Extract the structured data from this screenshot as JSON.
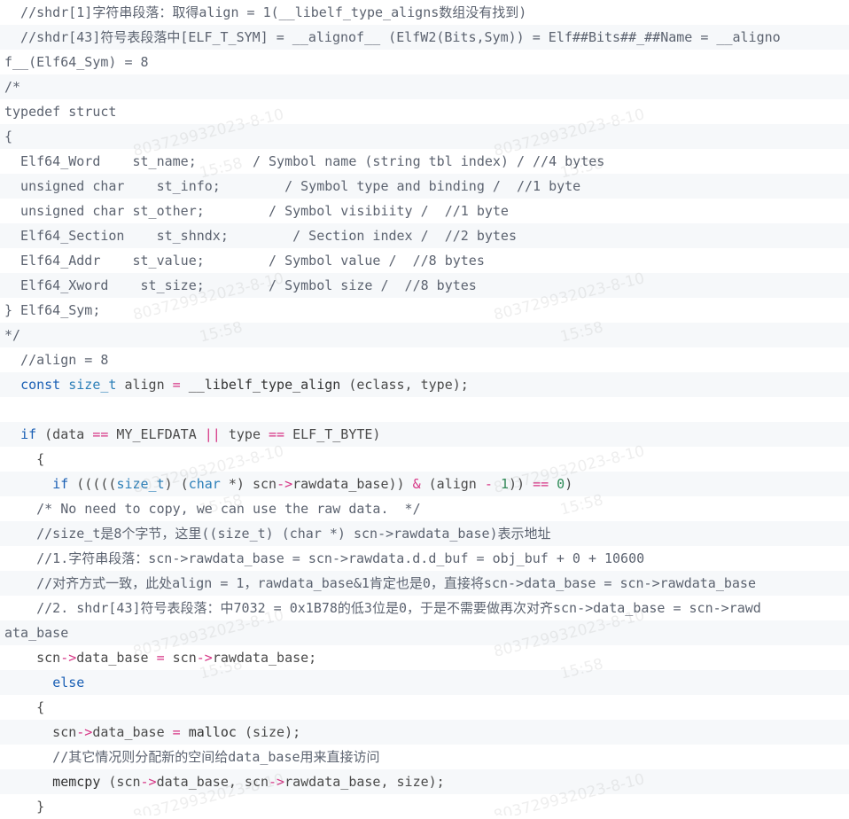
{
  "code_block": {
    "lines": [
      {
        "segments": [
          {
            "t": "  //shdr[1]字符串段落：取得align = 1(__libelf_type_aligns数组没有找到)",
            "c": "cm"
          }
        ]
      },
      {
        "segments": [
          {
            "t": "  //shdr[43]符号表段落中[ELF_T_SYM] = __alignof__ (ElfW2(Bits,Sym)) = Elf##Bits##_##Name = __aligno",
            "c": "cm"
          }
        ]
      },
      {
        "segments": [
          {
            "t": "f__(Elf64_Sym) = 8",
            "c": "cm"
          }
        ]
      },
      {
        "segments": [
          {
            "t": "/*",
            "c": "cm"
          }
        ]
      },
      {
        "segments": [
          {
            "t": "typedef struct",
            "c": "cm"
          }
        ]
      },
      {
        "segments": [
          {
            "t": "{",
            "c": "cm"
          }
        ]
      },
      {
        "segments": [
          {
            "t": "  Elf64_Word    st_name;       / Symbol name (string tbl index) / //4 bytes",
            "c": "cm"
          }
        ]
      },
      {
        "segments": [
          {
            "t": "  unsigned char    st_info;        / Symbol type and binding /  //1 byte",
            "c": "cm"
          }
        ]
      },
      {
        "segments": [
          {
            "t": "  unsigned char st_other;        / Symbol visibiity /  //1 byte",
            "c": "cm"
          }
        ]
      },
      {
        "segments": [
          {
            "t": "  Elf64_Section    st_shndx;        / Section index /  //2 bytes",
            "c": "cm"
          }
        ]
      },
      {
        "segments": [
          {
            "t": "  Elf64_Addr    st_value;        / Symbol value /  //8 bytes",
            "c": "cm"
          }
        ]
      },
      {
        "segments": [
          {
            "t": "  Elf64_Xword    st_size;        / Symbol size /  //8 bytes",
            "c": "cm"
          }
        ]
      },
      {
        "segments": [
          {
            "t": "} Elf64_Sym;",
            "c": "cm"
          }
        ]
      },
      {
        "segments": [
          {
            "t": "*/",
            "c": "cm"
          }
        ]
      },
      {
        "segments": [
          {
            "t": "  //align = 8",
            "c": "cm"
          }
        ]
      },
      {
        "segments": [
          {
            "t": "  ",
            "c": "tx"
          },
          {
            "t": "const",
            "c": "kw"
          },
          {
            "t": " ",
            "c": "tx"
          },
          {
            "t": "size_t",
            "c": "ty"
          },
          {
            "t": " align ",
            "c": "tx"
          },
          {
            "t": "=",
            "c": "op"
          },
          {
            "t": " __libelf_type_align ",
            "c": "fn"
          },
          {
            "t": "(eclass, type);",
            "c": "tx"
          }
        ]
      },
      {
        "segments": [
          {
            "t": "",
            "c": "tx"
          }
        ]
      },
      {
        "segments": [
          {
            "t": "  ",
            "c": "tx"
          },
          {
            "t": "if",
            "c": "kw"
          },
          {
            "t": " (data ",
            "c": "tx"
          },
          {
            "t": "==",
            "c": "op"
          },
          {
            "t": " MY_ELFDATA ",
            "c": "tx"
          },
          {
            "t": "||",
            "c": "op"
          },
          {
            "t": " type ",
            "c": "tx"
          },
          {
            "t": "==",
            "c": "op"
          },
          {
            "t": " ELF_T_BYTE)",
            "c": "tx"
          }
        ]
      },
      {
        "segments": [
          {
            "t": "    {",
            "c": "tx"
          }
        ]
      },
      {
        "segments": [
          {
            "t": "      ",
            "c": "tx"
          },
          {
            "t": "if",
            "c": "kw"
          },
          {
            "t": " (((((",
            "c": "tx"
          },
          {
            "t": "size_t",
            "c": "ty"
          },
          {
            "t": ") (",
            "c": "tx"
          },
          {
            "t": "char",
            "c": "ty"
          },
          {
            "t": " *) scn",
            "c": "tx"
          },
          {
            "t": "->",
            "c": "op"
          },
          {
            "t": "rawdata_base)) ",
            "c": "tx"
          },
          {
            "t": "&",
            "c": "op"
          },
          {
            "t": " (align ",
            "c": "tx"
          },
          {
            "t": "-",
            "c": "op"
          },
          {
            "t": " ",
            "c": "tx"
          },
          {
            "t": "1",
            "c": "num"
          },
          {
            "t": ")) ",
            "c": "tx"
          },
          {
            "t": "==",
            "c": "op"
          },
          {
            "t": " ",
            "c": "tx"
          },
          {
            "t": "0",
            "c": "num"
          },
          {
            "t": ")",
            "c": "tx"
          }
        ]
      },
      {
        "segments": [
          {
            "t": "    /* No need to copy, we can use the raw data.  */",
            "c": "cm"
          }
        ]
      },
      {
        "segments": [
          {
            "t": "    //size_t是8个字节，这里((size_t) (char *) scn->rawdata_base)表示地址",
            "c": "cm"
          }
        ]
      },
      {
        "segments": [
          {
            "t": "    //1.字符串段落：scn->rawdata_base = scn->rawdata.d.d_buf = obj_buf + 0 + 10600",
            "c": "cm"
          }
        ]
      },
      {
        "segments": [
          {
            "t": "    //对齐方式一致，此处align = 1，rawdata_base&1肯定也是0，直接将scn->data_base = scn->rawdata_base",
            "c": "cm"
          }
        ]
      },
      {
        "segments": [
          {
            "t": "    //2. shdr[43]符号表段落：中7032 = 0x1B78的低3位是0，于是不需要做再次对齐scn->data_base = scn->rawd",
            "c": "cm"
          }
        ]
      },
      {
        "segments": [
          {
            "t": "ata_base",
            "c": "cm"
          }
        ]
      },
      {
        "segments": [
          {
            "t": "    scn",
            "c": "tx"
          },
          {
            "t": "->",
            "c": "op"
          },
          {
            "t": "data_base ",
            "c": "tx"
          },
          {
            "t": "=",
            "c": "op"
          },
          {
            "t": " scn",
            "c": "tx"
          },
          {
            "t": "->",
            "c": "op"
          },
          {
            "t": "rawdata_base;",
            "c": "tx"
          }
        ]
      },
      {
        "segments": [
          {
            "t": "      ",
            "c": "tx"
          },
          {
            "t": "else",
            "c": "kw"
          }
        ]
      },
      {
        "segments": [
          {
            "t": "    {",
            "c": "tx"
          }
        ]
      },
      {
        "segments": [
          {
            "t": "      scn",
            "c": "tx"
          },
          {
            "t": "->",
            "c": "op"
          },
          {
            "t": "data_base ",
            "c": "tx"
          },
          {
            "t": "=",
            "c": "op"
          },
          {
            "t": " malloc ",
            "c": "fn"
          },
          {
            "t": "(size);",
            "c": "tx"
          }
        ]
      },
      {
        "segments": [
          {
            "t": "      //其它情况则分配新的空间给data_base用来直接访问",
            "c": "cm"
          }
        ]
      },
      {
        "segments": [
          {
            "t": "      memcpy ",
            "c": "fn"
          },
          {
            "t": "(scn",
            "c": "tx"
          },
          {
            "t": "->",
            "c": "op"
          },
          {
            "t": "data_base, scn",
            "c": "tx"
          },
          {
            "t": "->",
            "c": "op"
          },
          {
            "t": "rawdata_base, size);",
            "c": "tx"
          }
        ]
      },
      {
        "segments": [
          {
            "t": "    }",
            "c": "tx"
          }
        ]
      }
    ]
  },
  "watermark": {
    "id_text": "803729932023-8-10",
    "time_text": "15:58"
  }
}
